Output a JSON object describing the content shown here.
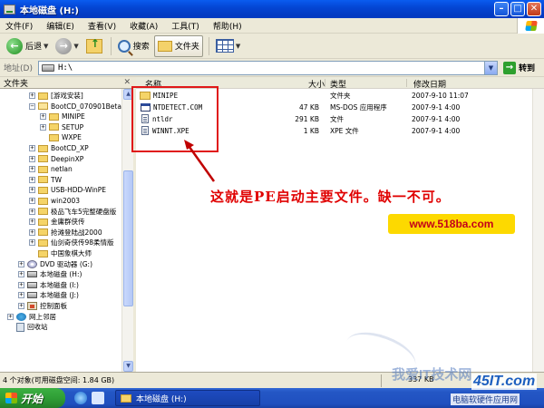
{
  "window": {
    "title": "本地磁盘 (H:)"
  },
  "title_buttons": {
    "minimize": "–",
    "maximize": "□",
    "close": "✕"
  },
  "menu": [
    "文件(F)",
    "编辑(E)",
    "查看(V)",
    "收藏(A)",
    "工具(T)",
    "帮助(H)"
  ],
  "toolbar": {
    "back": "后退",
    "search": "搜索",
    "folders": "文件夹"
  },
  "address": {
    "label": "地址(D)",
    "value": "H:\\",
    "go": "转到"
  },
  "left_panel": {
    "title": "文件夹",
    "close": "✕",
    "items": [
      {
        "label": "[游戏安装]",
        "level": 2,
        "expander": "+",
        "icon": "folder-icon"
      },
      {
        "label": "BootCD_070901Beta(",
        "level": 2,
        "expander": "−",
        "icon": "folder-icon",
        "open": true
      },
      {
        "label": "MINIPE",
        "level": 3,
        "expander": "+",
        "icon": "folder-icon"
      },
      {
        "label": "SETUP",
        "level": 3,
        "expander": "+",
        "icon": "folder-icon"
      },
      {
        "label": "WXPE",
        "level": 3,
        "expander": "",
        "icon": "folder-icon"
      },
      {
        "label": "BootCD_XP",
        "level": 2,
        "expander": "+",
        "icon": "folder-icon"
      },
      {
        "label": "DeepinXP",
        "level": 2,
        "expander": "+",
        "icon": "folder-icon"
      },
      {
        "label": "netlan",
        "level": 2,
        "expander": "+",
        "icon": "folder-icon"
      },
      {
        "label": "TW",
        "level": 2,
        "expander": "+",
        "icon": "folder-icon"
      },
      {
        "label": "USB-HDD-WinPE",
        "level": 2,
        "expander": "+",
        "icon": "folder-icon"
      },
      {
        "label": "win2003",
        "level": 2,
        "expander": "+",
        "icon": "folder-icon"
      },
      {
        "label": "极品飞车5完整硬盘版",
        "level": 2,
        "expander": "+",
        "icon": "folder-icon"
      },
      {
        "label": "金庸群侠传",
        "level": 2,
        "expander": "+",
        "icon": "folder-icon"
      },
      {
        "label": "抢滩登陆战2000",
        "level": 2,
        "expander": "+",
        "icon": "folder-icon"
      },
      {
        "label": "仙剑奇侠传98柔情版",
        "level": 2,
        "expander": "+",
        "icon": "folder-icon"
      },
      {
        "label": "中国象棋大师",
        "level": 2,
        "expander": "",
        "icon": "folder-icon"
      },
      {
        "label": "DVD 驱动器 (G:)",
        "level": 1,
        "expander": "+",
        "icon": "cd-icon"
      },
      {
        "label": "本地磁盘 (H:)",
        "level": 1,
        "expander": "+",
        "icon": "drive-icon"
      },
      {
        "label": "本地磁盘 (I:)",
        "level": 1,
        "expander": "+",
        "icon": "drive-icon"
      },
      {
        "label": "本地磁盘 (J:)",
        "level": 1,
        "expander": "+",
        "icon": "drive-icon"
      },
      {
        "label": "控制面板",
        "level": 1,
        "expander": "+",
        "icon": "control-panel-icon"
      },
      {
        "label": "网上邻居",
        "level": 0,
        "expander": "+",
        "icon": "network-icon"
      },
      {
        "label": "回收站",
        "level": 0,
        "expander": "",
        "icon": "recycle-bin-icon"
      }
    ]
  },
  "columns": {
    "name": "名称",
    "size": "大小",
    "type": "类型",
    "date": "修改日期"
  },
  "files": [
    {
      "name": "MINIPE",
      "size": "",
      "type": "文件夹",
      "date": "2007-9-10 11:07",
      "icon": "folder-icon"
    },
    {
      "name": "NTDETECT.COM",
      "size": "47 KB",
      "type": "MS-DOS 应用程序",
      "date": "2007-9-1 4:00",
      "icon": "exe-icon"
    },
    {
      "name": "ntldr",
      "size": "291 KB",
      "type": "文件",
      "date": "2007-9-1 4:00",
      "icon": "file-icon"
    },
    {
      "name": "WINNT.XPE",
      "size": "1 KB",
      "type": "XPE 文件",
      "date": "2007-9-1 4:00",
      "icon": "file-icon"
    }
  ],
  "annotation": {
    "text": "这就是PE启动主要文件。缺一不可。",
    "color": "#e00000"
  },
  "brand": {
    "text": "www.518ba.com",
    "bg": "#fdd900",
    "color": "#c4001a"
  },
  "status": {
    "text": "4 个对象(可用磁盘空间: 1.84 GB)",
    "size": "337 KB"
  },
  "taskbar": {
    "start": "开始",
    "task": "本地磁盘 (H:)"
  },
  "watermark": {
    "text": "我爱IT技术网",
    "logo": "45IT.com",
    "sub": "电脑软硬件应用网"
  }
}
